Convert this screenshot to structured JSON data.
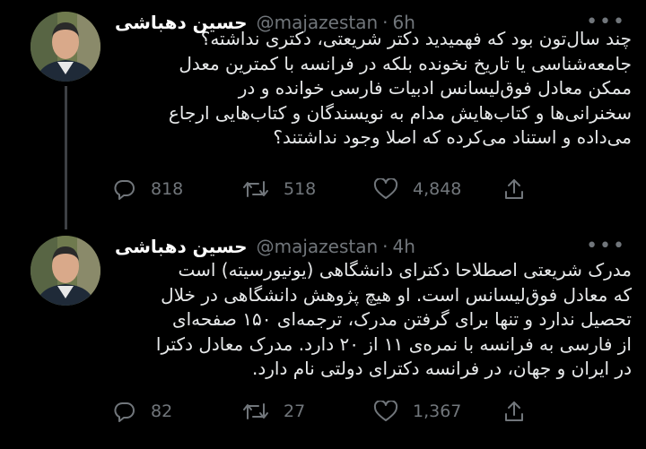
{
  "theme": {
    "background": "#000000",
    "text": "#e7e9ea",
    "muted": "#71767b",
    "thread_line": "#3d4044"
  },
  "tweets": [
    {
      "display_name": "حسین دهباشی",
      "handle": "@majazestan",
      "separator": "·",
      "time": "6h",
      "more_label": "•••",
      "lines": [
        "چند سال‌تون بود که فهمیدید دکتر شریعتی، دکتری نداشته؟",
        "جامعه‌شناسی یا تاریخ نخونده بلکه در فرانسه با کمترین معدل",
        "ممکن معادل فوق‌لیسانس ادبیات فارسی خوانده و در",
        "سخنرانی‌ها و کتاب‌هایش مدام به نویسندگان و کتاب‌هایی ارجاع",
        "می‌داده و استناد می‌کرده که اصلا وجود نداشتند؟"
      ],
      "replies": "818",
      "retweets": "518",
      "likes": "4,848"
    },
    {
      "display_name": "حسین دهباشی",
      "handle": "@majazestan",
      "separator": "·",
      "time": "4h",
      "more_label": "•••",
      "lines": [
        "مدرک شریعتی اصطلاحا دکترای دانشگاهی (یونیورسیته) است",
        "که معادل فوق‌لیسانس است. او هیچ پژوهش دانشگاهی در خلال",
        "تحصیل ندارد و تنها برای گرفتن مدرک، ترجمه‌ای ۱۵۰ صفحه‌ای",
        "از فارسی به فرانسه با نمره‌ی ۱۱ از ۲۰ دارد. مدرک معادل دکترا",
        "در ایران و جهان، در فرانسه دکترای دولتی نام دارد."
      ],
      "replies": "82",
      "retweets": "27",
      "likes": "1,367"
    }
  ]
}
